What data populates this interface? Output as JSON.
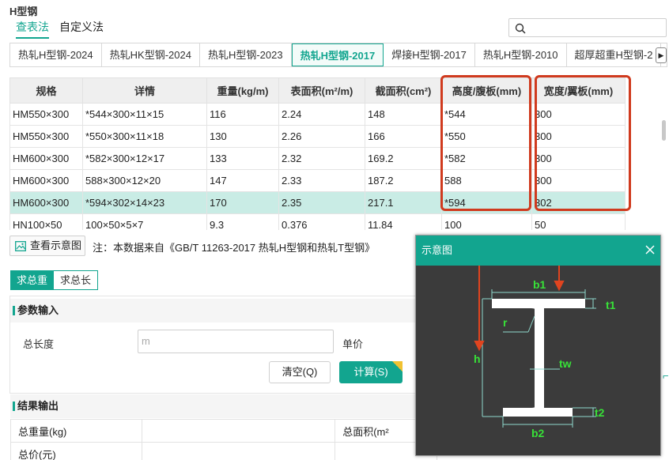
{
  "app": {
    "title": "H型钢"
  },
  "modes": [
    {
      "label": "查表法",
      "active": true
    },
    {
      "label": "自定义法",
      "active": false
    }
  ],
  "search": {
    "placeholder": "",
    "icon": "search-icon"
  },
  "standard_tabs": [
    {
      "label": "热轧H型钢-2024",
      "active": false
    },
    {
      "label": "热轧HK型钢-2024",
      "active": false
    },
    {
      "label": "热轧H型钢-2023",
      "active": false
    },
    {
      "label": "热轧H型钢-2017",
      "active": true
    },
    {
      "label": "焊接H型钢-2017",
      "active": false
    },
    {
      "label": "热轧H型钢-2010",
      "active": false
    },
    {
      "label": "超厚超重H型钢-2",
      "active": false
    }
  ],
  "table": {
    "columns": [
      "规格",
      "详情",
      "重量(kg/m)",
      "表面积(m²/m)",
      "截面积(cm²)",
      "高度/腹板(mm)",
      "宽度/翼板(mm)"
    ],
    "selected_row": 4,
    "rows": [
      [
        "HM550×300",
        "*544×300×11×15",
        "116",
        "2.24",
        "148",
        "*544",
        "300"
      ],
      [
        "HM550×300",
        "*550×300×11×18",
        "130",
        "2.26",
        "166",
        "*550",
        "300"
      ],
      [
        "HM600×300",
        "*582×300×12×17",
        "133",
        "2.32",
        "169.2",
        "*582",
        "300"
      ],
      [
        "HM600×300",
        "588×300×12×20",
        "147",
        "2.33",
        "187.2",
        "588",
        "300"
      ],
      [
        "HM600×300",
        "*594×302×14×23",
        "170",
        "2.35",
        "217.1",
        "*594",
        "302"
      ],
      [
        "HN100×50",
        "100×50×5×7",
        "9.3",
        "0.376",
        "11.84",
        "100",
        "50"
      ]
    ]
  },
  "diagram_button": {
    "label": "查看示意图",
    "icon": "image-icon"
  },
  "note": "注：本数据来自《GB/T 11263-2017 热轧H型钢和热轧T型钢》",
  "calc_tabs": [
    {
      "label": "求总重",
      "active": true
    },
    {
      "label": "求总长",
      "active": false
    }
  ],
  "params": {
    "header": "参数输入",
    "length_label": "总长度",
    "length_placeholder": "m",
    "price_label": "单价",
    "clear_label": "清空(Q)",
    "calc_label": "计算(S)"
  },
  "results": {
    "header": "结果输出",
    "total_weight_label": "总重量(kg)",
    "total_area_label": "总面积(m²",
    "total_price_label": "总价(元)"
  },
  "dialog": {
    "title": "示意图",
    "labels": {
      "b1": "b1",
      "t1": "t1",
      "r": "r",
      "h": "h",
      "tw": "tw",
      "t2": "t2",
      "b2": "b2"
    }
  },
  "colors": {
    "accent": "#12a58f",
    "highlight": "#d03a1e",
    "dim_green": "#38e138",
    "selected_row": "#c9ece5"
  }
}
